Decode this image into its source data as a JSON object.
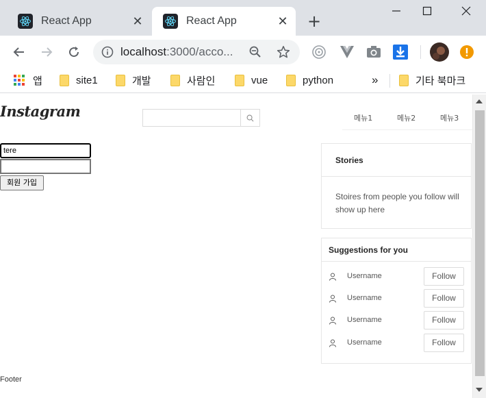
{
  "browser": {
    "tabs": [
      {
        "title": "React App",
        "active": false,
        "icon": "react-icon"
      },
      {
        "title": "React App",
        "active": true,
        "icon": "react-icon"
      }
    ],
    "new_tab_icon": "plus-icon",
    "window_controls": [
      "minimize-icon",
      "maximize-icon",
      "close-icon"
    ],
    "url": {
      "host": "localhost",
      "path": ":3000/acco..."
    },
    "bookmarks": [
      {
        "label": "앱",
        "icon": "apps-grid-icon"
      },
      {
        "label": "site1",
        "icon": "folder-icon"
      },
      {
        "label": "개발",
        "icon": "folder-icon"
      },
      {
        "label": "사람인",
        "icon": "folder-icon"
      },
      {
        "label": "vue",
        "icon": "folder-icon"
      },
      {
        "label": "python",
        "icon": "folder-icon"
      }
    ],
    "overflow": "»",
    "other_bookmarks": "기타 북마크"
  },
  "page": {
    "logo": "Instagram",
    "search": {
      "value": "",
      "icon": "search-icon"
    },
    "menus": [
      "메뉴1",
      "메뉴2",
      "메뉴3"
    ],
    "form": {
      "field1_value": "tere",
      "field2_value": "",
      "submit_label": "회원 가입"
    },
    "stories": {
      "title": "Stories",
      "body": "Stoires from people you follow will show up here"
    },
    "suggestions": {
      "title": "Suggestions for you",
      "items": [
        {
          "name": "Username",
          "button": "Follow"
        },
        {
          "name": "Username",
          "button": "Follow"
        },
        {
          "name": "Username",
          "button": "Follow"
        },
        {
          "name": "Username",
          "button": "Follow"
        }
      ]
    },
    "footer": "Footer"
  },
  "colors": {
    "chrome_bg": "#dee1e6",
    "accent_orange": "#f29900",
    "download_blue": "#1a73e8"
  }
}
